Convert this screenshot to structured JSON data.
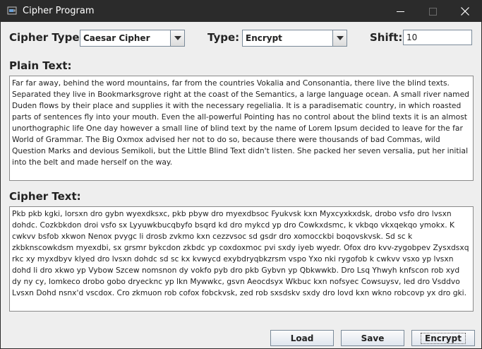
{
  "window": {
    "title": "Cipher Program"
  },
  "controls": {
    "cipher_type_label": "Cipher Type:",
    "cipher_type_value": "Caesar Cipher",
    "type_label": "Type:",
    "type_value": "Encrypt",
    "shift_label": "Shift:",
    "shift_value": "10"
  },
  "plain": {
    "label": "Plain Text:",
    "text": "Far far away, behind the word mountains, far from the countries Vokalia and Consonantia, there live the blind texts. Separated they live in Bookmarksgrove right at the coast of the Semantics, a large language ocean. A small river named Duden flows by their place and supplies it with the necessary regelialia. It is a paradisematic country, in which roasted parts of sentences fly into your mouth. Even the all-powerful Pointing has no control about the blind texts it is an almost unorthographic life One day however a small line of blind text by the name of Lorem Ipsum decided to leave for the far World of Grammar. The Big Oxmox advised her not to do so, because there were thousands of bad Commas, wild Question Marks and devious Semikoli, but the Little Blind Text didn't listen. She packed her seven versalia, put her initial into the belt and made herself on the way."
  },
  "cipher": {
    "label": "Cipher Text:",
    "text": "Pkb pkb kgki, lorsxn dro gybn wyexdksxc, pkb pbyw dro myexdbsoc Fyukvsk kxn Myxcyxkxdsk, drobo vsfo dro lvsxn dohdc. Cozkbkdon droi vsfo sx Lyyuwkbucqbyfo bsqrd kd dro mykcd yp dro Cowkxdsmc, k vkbqo vkxqekqo ymokx. K cwkvv bsfob xkwon Nenox pvygc li drosb zvkmo kxn cezzvsoc sd gsdr dro xomocckbi boqovskvsk. Sd sc k zkbknscowkdsm myexdbi, sx grsmr bykcdon zkbdc yp coxdoxmoc pvi sxdy iyeb wyedr. Ofox dro kvv-zygobpev Zysxdsxq rkc xy myxdbyv klyed dro lvsxn dohdc sd sc kx kvwycd exybdryqbkzrsm vspo Yxo nki rygofob k cwkvv vsxo yp lvsxn dohd li dro xkwo yp Vybow Szcew nomsnon dy vokfo pyb dro pkb Gybvn yp Qbkwwkb. Dro Lsq Yhwyh knfscon rob xyd dy ny cy, lomkeco drobo gobo dryecknc yp lkn Mywwkc, gsvn Aeocdsyx Wkbuc kxn nofsyec Cowsuysv, led dro Vsddvo Lvsxn Dohd nsnx'd vscdox. Cro zkmuon rob cofox fobckvsk, zed rob sxsdskv sxdy dro lovd kxn wkno robcovp yx dro gki."
  },
  "buttons": {
    "load": "Load",
    "save": "Save",
    "encrypt": "Encrypt"
  },
  "colors": {
    "titlebar": "#2b2b2b",
    "window_bg": "#eeeeee",
    "button_gradient_bottom": "#dfe6ee"
  },
  "icons": {
    "app": "coffee-cup-icon",
    "minimize": "minimize-icon",
    "maximize": "maximize-icon",
    "close": "close-icon",
    "dropdown": "chevron-down-icon"
  }
}
